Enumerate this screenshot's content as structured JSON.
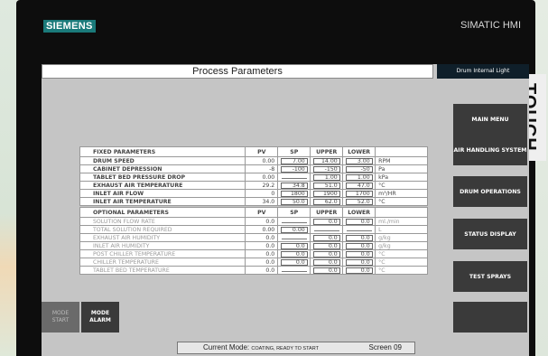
{
  "brand": "SIEMENS",
  "model": "SIMATIC HMI",
  "touch_label": "TOUCH",
  "screen_title": "Process Parameters",
  "indicator": "Drum Internal Light",
  "side_buttons": [
    "MAIN MENU",
    "AIR HANDLING SYSTEM",
    "DRUM OPERATIONS",
    "STATUS DISPLAY",
    "TEST SPRAYS"
  ],
  "fixed": {
    "headers": [
      "FIXED PARAMETERS",
      "PV",
      "SP",
      "UPPER",
      "LOWER"
    ],
    "rows": [
      {
        "name": "DRUM SPEED",
        "pv": "0.00",
        "sp": "7.00",
        "upper": "14.00",
        "lower": "3.00",
        "unit": "RPM"
      },
      {
        "name": "CABINET DEPRESSION",
        "pv": "-8",
        "sp": "-100",
        "upper": "-150",
        "lower": "-50",
        "unit": "Pa"
      },
      {
        "name": "TABLET BED PRESSURE DROP",
        "pv": "0.00",
        "sp": "",
        "upper": "1.00",
        "lower": "1.00",
        "unit": "kPa"
      },
      {
        "name": "EXHAUST AIR TEMPERATURE",
        "pv": "29.2",
        "sp": "34.8",
        "upper": "51.0",
        "lower": "47.0",
        "unit": "°C"
      },
      {
        "name": "INLET AIR FLOW",
        "pv": "0",
        "sp": "1800",
        "upper": "1900",
        "lower": "1700",
        "unit": "m³/HR"
      },
      {
        "name": "INLET AIR TEMPERATURE",
        "pv": "34.0",
        "sp": "50.0",
        "upper": "62.0",
        "lower": "52.0",
        "unit": "°C"
      }
    ]
  },
  "optional": {
    "headers": [
      "OPTIONAL PARAMETERS",
      "PV",
      "SP",
      "UPPER",
      "LOWER"
    ],
    "rows": [
      {
        "name": "SOLUTION FLOW RATE",
        "pv": "0.0",
        "sp": "",
        "upper": "0.0",
        "lower": "0.0",
        "unit": "ml./min"
      },
      {
        "name": "TOTAL SOLUTION REQUIRED",
        "pv": "0.00",
        "sp": "0.00",
        "upper": "",
        "lower": "",
        "unit": "L"
      },
      {
        "name": "EXHAUST AIR HUMIDITY",
        "pv": "0.0",
        "sp": "",
        "upper": "0.0",
        "lower": "0.0",
        "unit": "g/kg"
      },
      {
        "name": "INLET AIR HUMIDITY",
        "pv": "0.0",
        "sp": "0.0",
        "upper": "0.0",
        "lower": "0.0",
        "unit": "g/kg"
      },
      {
        "name": "POST CHILLER TEMPERATURE",
        "pv": "0.0",
        "sp": "0.0",
        "upper": "0.0",
        "lower": "0.0",
        "unit": "°C"
      },
      {
        "name": "CHILLER TEMPERATURE",
        "pv": "0.0",
        "sp": "0.0",
        "upper": "0.0",
        "lower": "0.0",
        "unit": "°C"
      },
      {
        "name": "TABLET BED TEMPERATURE",
        "pv": "0.0",
        "sp": "",
        "upper": "0.0",
        "lower": "0.0",
        "unit": "°C"
      }
    ]
  },
  "bottom_buttons": [
    {
      "line1": "MODE",
      "line2": "START"
    },
    {
      "line1": "MODE",
      "line2": "ALARM"
    }
  ],
  "status": {
    "label": "Current Mode:",
    "mode": "COATING, READY TO START",
    "screen": "Screen 09"
  }
}
